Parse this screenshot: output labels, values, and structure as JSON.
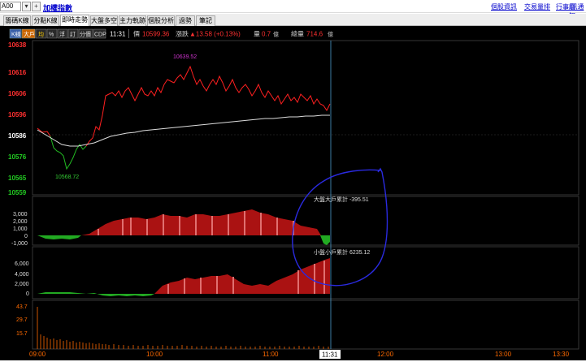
{
  "toolbar": {
    "code_value": "A00",
    "index_name": "加權指數",
    "links": [
      "個股資訊",
      "交易量排",
      "行事曆",
      "Ⅰ訊通知"
    ]
  },
  "tabs": [
    "籌碼K線",
    "分點K線",
    "即時走勢",
    "大盤多空",
    "主力軌跡",
    "個股分析",
    "過勢",
    "筆記"
  ],
  "active_tab": "即時走勢",
  "chart_toolbar": {
    "buttons": [
      "K線",
      "大戶",
      "均",
      "%",
      "浮",
      "訂",
      "分價",
      "CDP"
    ],
    "time": "11:31",
    "price_label": "價",
    "price_value": "10599.36",
    "change_label": "漲跌",
    "change_value": "▲13.58 (+0.13%)",
    "volume_label": "量",
    "volume_value": "0.7",
    "volume_unit": "億",
    "total_label": "總量",
    "total_value": "714.6",
    "total_unit": "億"
  },
  "price_panel": {
    "y_labels": [
      "10638",
      "10616",
      "10606",
      "10596",
      "10586",
      "10576",
      "10565",
      "10559"
    ],
    "high_label": "10639.52",
    "low_label": "10568.72"
  },
  "big_panel": {
    "y_labels": [
      "3,000",
      "2,000",
      "1,000",
      "0",
      "-1,000"
    ],
    "annotation": "大盤大戶累計  -395.51"
  },
  "small_panel": {
    "y_labels": [
      "6,000",
      "4,000",
      "2,000",
      "0"
    ],
    "annotation": "小盤小戶累計  6235.12"
  },
  "volume_panel": {
    "y_labels": [
      "43.7",
      "29.7",
      "15.7"
    ]
  },
  "x_axis": {
    "labels": [
      "09:00",
      "10:00",
      "11:00",
      "11:31",
      "12:00",
      "13:00",
      "13:30"
    ]
  },
  "colors": {
    "up": "#ff2020",
    "down": "#22bb22",
    "avg": "#dddddd",
    "crosshair": "#4a9acc",
    "pen": "#2a2adf"
  }
}
